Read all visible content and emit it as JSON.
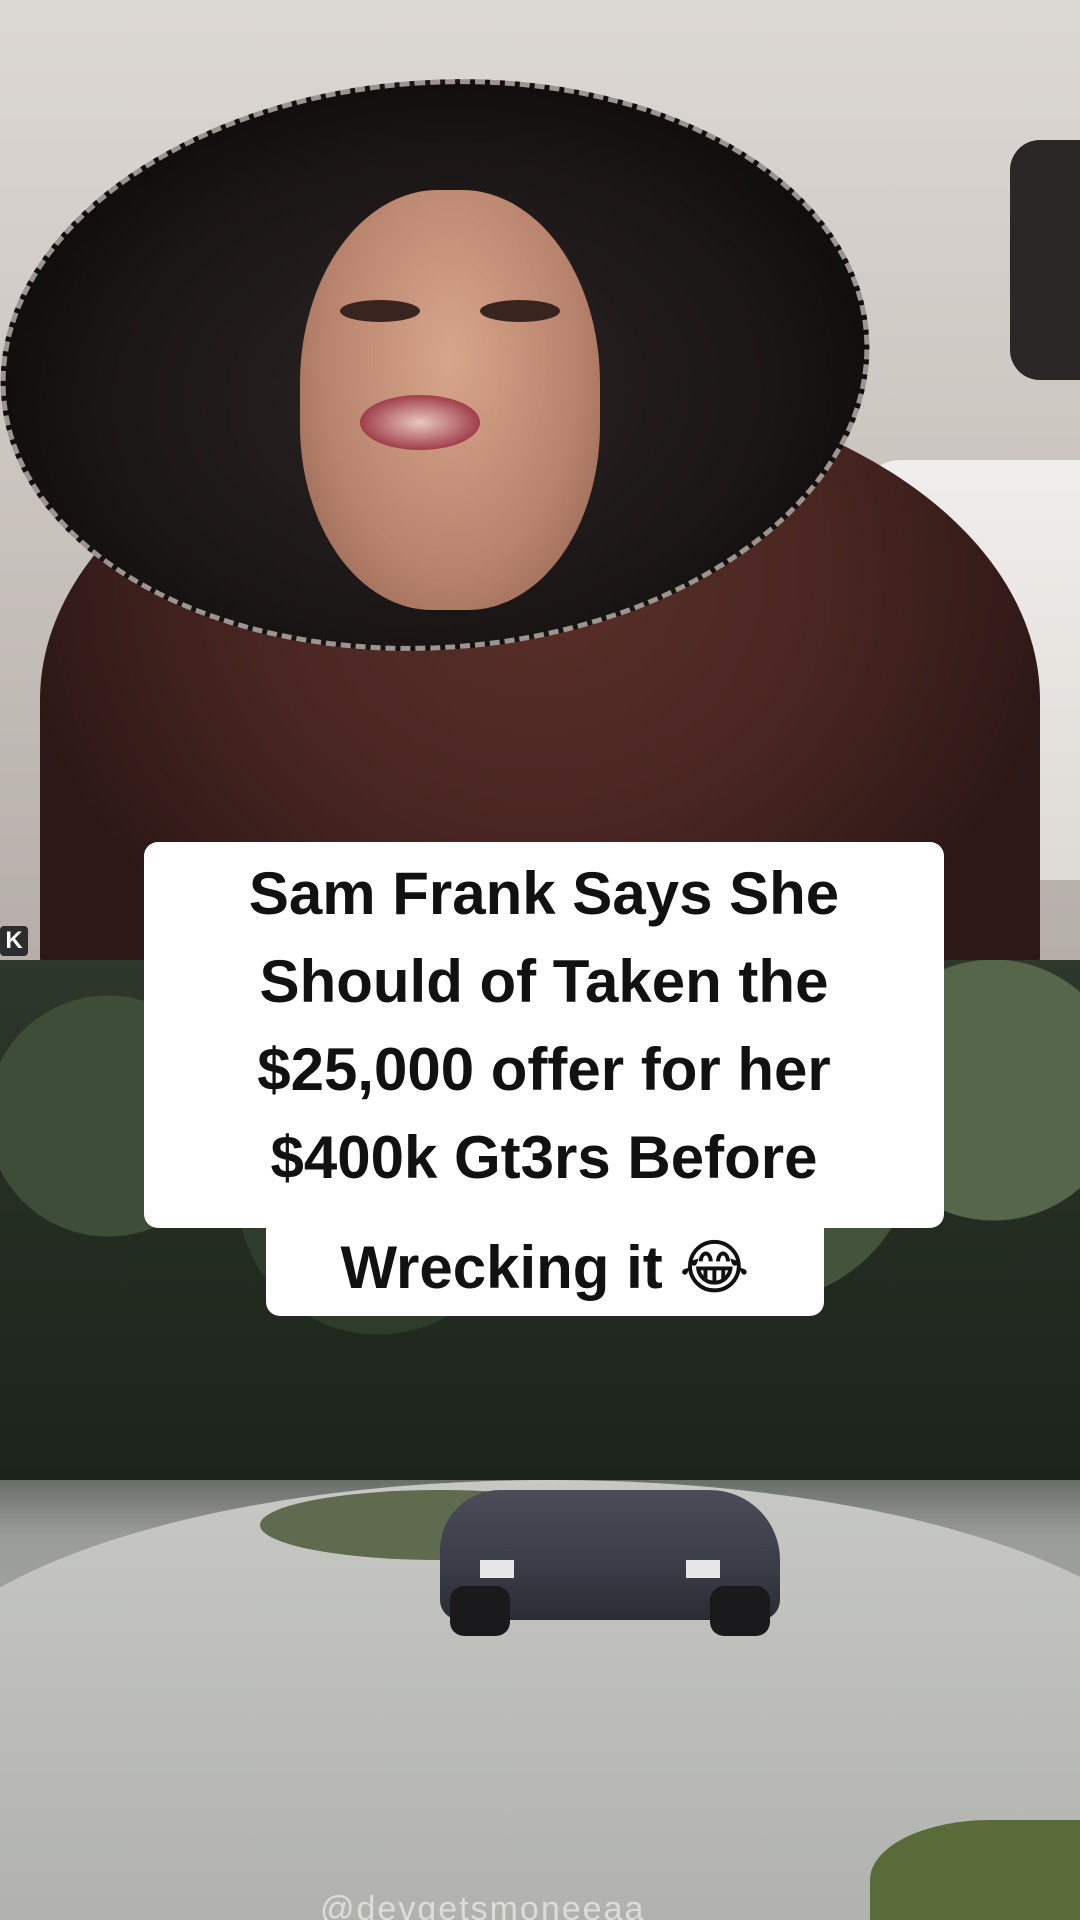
{
  "video": {
    "caption_lines": [
      "Sam Frank Says She",
      "Should of Taken the",
      "$25,000 offer for her",
      "$400k Gt3rs Before"
    ],
    "caption_last_line": "Wrecking it 😂",
    "watermark": "K",
    "credit": "@devgetsmoneeaa"
  }
}
